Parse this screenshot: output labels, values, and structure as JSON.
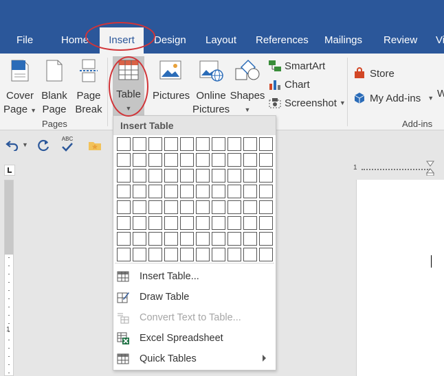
{
  "tabs": {
    "file": "File",
    "home": "Home",
    "insert": "Insert",
    "design": "Design",
    "layout": "Layout",
    "references": "References",
    "mailings": "Mailings",
    "review": "Review",
    "view": "Vi"
  },
  "ribbon": {
    "cover_page": [
      "Cover",
      "Page"
    ],
    "blank_page": [
      "Blank",
      "Page"
    ],
    "page_break": [
      "Page",
      "Break"
    ],
    "pages_group": "Pages",
    "table": "Table",
    "pictures": "Pictures",
    "online_pictures": [
      "Online",
      "Pictures"
    ],
    "shapes": "Shapes",
    "smartart": "SmartArt",
    "chart": "Chart",
    "screenshot": "Screenshot",
    "store": "Store",
    "my_addins": "My Add-ins",
    "addins_group": "Add-ins",
    "w_cut": "W"
  },
  "quick_access": {
    "spell_abc": "ABC"
  },
  "dropdown": {
    "header": "Insert Table",
    "items": [
      {
        "label": "Insert Table..."
      },
      {
        "label": "Draw Table"
      },
      {
        "label": "Convert Text to Table..."
      },
      {
        "label": "Excel Spreadsheet"
      },
      {
        "label": "Quick Tables"
      }
    ]
  },
  "ruler": {
    "h_start": "1",
    "v_ticks": [
      "1"
    ]
  },
  "colors": {
    "brand": "#2b579a",
    "annotation": "#d13438",
    "excel": "#217346"
  }
}
